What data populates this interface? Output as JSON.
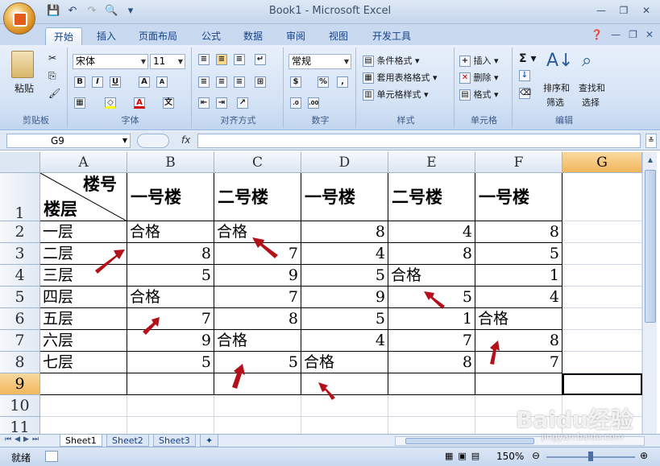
{
  "window": {
    "title": "Book1 - Microsoft Excel"
  },
  "tabs": [
    "开始",
    "插入",
    "页面布局",
    "公式",
    "数据",
    "审阅",
    "视图",
    "开发工具"
  ],
  "ribbon": {
    "clipboard": {
      "paste": "粘贴",
      "label": "剪贴板"
    },
    "font": {
      "name": "宋体",
      "size": "11",
      "label": "字体"
    },
    "alignment": {
      "label": "对齐方式"
    },
    "number": {
      "format": "常规",
      "label": "数字"
    },
    "styles": {
      "conditional": "条件格式",
      "table": "套用表格格式",
      "cell": "单元格样式",
      "label": "样式"
    },
    "cells": {
      "insert": "插入",
      "delete": "删除",
      "format": "格式",
      "label": "单元格"
    },
    "editing": {
      "sort1": "排序和",
      "sort2": "筛选",
      "find1": "查找和",
      "find2": "选择",
      "label": "编辑"
    }
  },
  "formula_bar": {
    "name_box": "G9",
    "fx": "fx",
    "content": ""
  },
  "columns": [
    "A",
    "B",
    "C",
    "D",
    "E",
    "F",
    "G"
  ],
  "rows": [
    "1",
    "2",
    "3",
    "4",
    "5",
    "6",
    "7",
    "8",
    "9",
    "10",
    "11"
  ],
  "header_cell": {
    "top": "楼号",
    "bottom": "楼层"
  },
  "header_row": [
    "一号楼",
    "二号楼",
    "一号楼",
    "二号楼",
    "一号楼"
  ],
  "data_rows": [
    {
      "label": "一层",
      "cells": [
        "合格",
        "合格",
        "8",
        "4",
        "8"
      ]
    },
    {
      "label": "二层",
      "cells": [
        "8",
        "7",
        "4",
        "8",
        "5"
      ]
    },
    {
      "label": "三层",
      "cells": [
        "5",
        "9",
        "5",
        "合格",
        "1"
      ]
    },
    {
      "label": "四层",
      "cells": [
        "合格",
        "7",
        "9",
        "5",
        "4"
      ]
    },
    {
      "label": "五层",
      "cells": [
        "7",
        "8",
        "5",
        "1",
        "合格"
      ]
    },
    {
      "label": "六层",
      "cells": [
        "9",
        "合格",
        "4",
        "7",
        "8"
      ]
    },
    {
      "label": "七层",
      "cells": [
        "5",
        "5",
        "合格",
        "8",
        "7"
      ]
    }
  ],
  "sheets": [
    "Sheet1",
    "Sheet2",
    "Sheet3"
  ],
  "status": {
    "ready": "就绪",
    "zoom": "150%"
  },
  "watermark": {
    "line1": "Baidu经验",
    "line2": "jingyan.baidu.com"
  }
}
